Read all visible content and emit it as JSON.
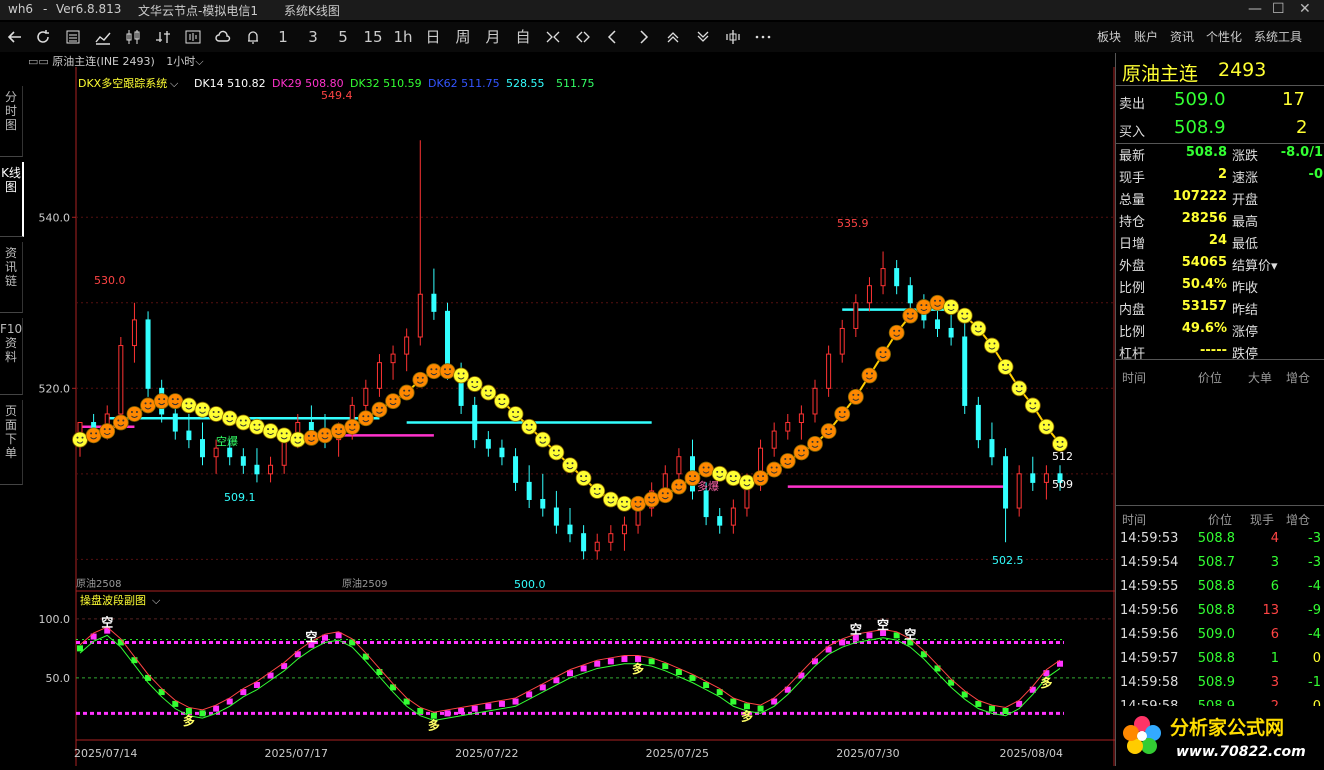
{
  "window": {
    "app_name": "wh6",
    "sep": "-",
    "version": "Ver6.8.813",
    "server": "文华云节点-模拟电信1",
    "view": "系统K线图",
    "controls": [
      "—",
      "☐",
      "✕"
    ]
  },
  "toolbar": {
    "periods": [
      "1",
      "3",
      "5",
      "15",
      "1h",
      "日",
      "周",
      "月",
      "自"
    ],
    "menus": [
      "板块",
      "账户",
      "资讯",
      "个性化",
      "系统工具"
    ]
  },
  "side_tabs": [
    {
      "label": "分时图",
      "active": false
    },
    {
      "label": "K线图",
      "active": true
    },
    {
      "label": "资讯链",
      "active": false
    },
    {
      "label": "F10资料",
      "active": false
    },
    {
      "label": "页面下单",
      "active": false
    }
  ],
  "chart_header": {
    "symbol": "原油主连(INE 2493)",
    "period": "1小时"
  },
  "main_indicator": {
    "name": "DKX多空跟踪系统",
    "items": [
      {
        "label": "DK14",
        "value": "510.82",
        "color": "#ffffff"
      },
      {
        "label": "DK29",
        "value": "508.80",
        "color": "#ff33cc"
      },
      {
        "label": "DK32",
        "value": "510.59",
        "color": "#33ff33"
      },
      {
        "label": "DK62",
        "value": "511.75",
        "color": "#3355ff"
      },
      {
        "label": "",
        "value": "528.55",
        "color": "#33ffff"
      },
      {
        "label": "",
        "value": "511.75",
        "color": "#33ff66"
      }
    ]
  },
  "sub_indicator": {
    "name": "操盘波段副图"
  },
  "contract_labels": [
    "原油2508",
    "原油2509"
  ],
  "chart_data": {
    "type": "candlestick",
    "y_ticks": [
      "540.0",
      "520.0"
    ],
    "sub_y_ticks": [
      "100.0",
      "50.0"
    ],
    "x_ticks": [
      "2025/07/14",
      "2025/07/17",
      "2025/07/22",
      "2025/07/25",
      "2025/07/30",
      "2025/08/04"
    ],
    "ylim": [
      497,
      555
    ],
    "annotations": [
      {
        "text": "530.0",
        "color": "#ff4444"
      },
      {
        "text": "549.4",
        "color": "#ff4444"
      },
      {
        "text": "535.9",
        "color": "#ff4444"
      },
      {
        "text": "509.1",
        "color": "#33ffff"
      },
      {
        "text": "500.0",
        "color": "#33ffff"
      },
      {
        "text": "502.5",
        "color": "#33ffff"
      },
      {
        "text": "512",
        "color": "#ffffff"
      },
      {
        "text": "509",
        "color": "#ffffff"
      }
    ],
    "signals": [
      "空爆",
      "多爆",
      "空",
      "多"
    ],
    "bars": [
      [
        514,
        516,
        512,
        516
      ],
      [
        516,
        517,
        514,
        515
      ],
      [
        515,
        518,
        514,
        517
      ],
      [
        517,
        526,
        516,
        525
      ],
      [
        525,
        530,
        523,
        528
      ],
      [
        528,
        529,
        519,
        520
      ],
      [
        520,
        521,
        516,
        517
      ],
      [
        517,
        519,
        514,
        515
      ],
      [
        515,
        517,
        513,
        514
      ],
      [
        514,
        516,
        511,
        512
      ],
      [
        512,
        514,
        510,
        513
      ],
      [
        513,
        514,
        511,
        512
      ],
      [
        512,
        513,
        510,
        511
      ],
      [
        511,
        513,
        509,
        510
      ],
      [
        510,
        512,
        509,
        511
      ],
      [
        511,
        515,
        510,
        514
      ],
      [
        514,
        517,
        513,
        516
      ],
      [
        516,
        518,
        514,
        515
      ],
      [
        515,
        517,
        513,
        514
      ],
      [
        514,
        516,
        512,
        515
      ],
      [
        515,
        519,
        514,
        518
      ],
      [
        518,
        521,
        517,
        520
      ],
      [
        520,
        524,
        519,
        523
      ],
      [
        523,
        525,
        521,
        524
      ],
      [
        524,
        527,
        522,
        526
      ],
      [
        526,
        549,
        525,
        531
      ],
      [
        531,
        534,
        528,
        529
      ],
      [
        529,
        530,
        521,
        522
      ],
      [
        522,
        523,
        517,
        518
      ],
      [
        518,
        519,
        513,
        514
      ],
      [
        514,
        515,
        512,
        513
      ],
      [
        513,
        514,
        511,
        512
      ],
      [
        512,
        513,
        508,
        509
      ],
      [
        509,
        511,
        506,
        507
      ],
      [
        507,
        510,
        505,
        506
      ],
      [
        506,
        508,
        503,
        504
      ],
      [
        504,
        506,
        502,
        503
      ],
      [
        503,
        504,
        500,
        501
      ],
      [
        501,
        503,
        500,
        502
      ],
      [
        502,
        504,
        501,
        503
      ],
      [
        503,
        505,
        501,
        504
      ],
      [
        504,
        507,
        503,
        506
      ],
      [
        506,
        509,
        505,
        508
      ],
      [
        508,
        511,
        507,
        510
      ],
      [
        510,
        513,
        509,
        512
      ],
      [
        512,
        514,
        507,
        508
      ],
      [
        508,
        509,
        504,
        505
      ],
      [
        505,
        506,
        503,
        504
      ],
      [
        504,
        507,
        503,
        506
      ],
      [
        506,
        510,
        505,
        509
      ],
      [
        509,
        514,
        508,
        513
      ],
      [
        513,
        516,
        512,
        515
      ],
      [
        515,
        517,
        514,
        516
      ],
      [
        516,
        518,
        514,
        517
      ],
      [
        517,
        521,
        516,
        520
      ],
      [
        520,
        525,
        519,
        524
      ],
      [
        524,
        528,
        523,
        527
      ],
      [
        527,
        531,
        526,
        530
      ],
      [
        530,
        533,
        529,
        532
      ],
      [
        532,
        536,
        531,
        534
      ],
      [
        534,
        535,
        531,
        532
      ],
      [
        532,
        533,
        529,
        530
      ],
      [
        530,
        531,
        527,
        528
      ],
      [
        528,
        530,
        526,
        527
      ],
      [
        527,
        529,
        525,
        526
      ],
      [
        526,
        528,
        517,
        518
      ],
      [
        518,
        519,
        513,
        514
      ],
      [
        514,
        516,
        511,
        512
      ],
      [
        512,
        513,
        502,
        506
      ],
      [
        506,
        511,
        505,
        510
      ],
      [
        510,
        512,
        508,
        509
      ],
      [
        509,
        511,
        507,
        510
      ],
      [
        510,
        511,
        508,
        509
      ]
    ],
    "dkx_line": [
      514,
      514.5,
      515,
      516,
      517,
      518,
      518.5,
      518.5,
      518,
      517.5,
      517,
      516.5,
      516,
      515.5,
      515,
      514.5,
      514,
      514.2,
      514.5,
      515,
      515.5,
      516.5,
      517.5,
      518.5,
      519.5,
      521,
      522,
      522,
      521.5,
      520.5,
      519.5,
      518.5,
      517,
      515.5,
      514,
      512.5,
      511,
      509.5,
      508,
      507,
      506.5,
      506.5,
      507,
      507.5,
      508.5,
      509.5,
      510.5,
      510,
      509.5,
      509,
      509.5,
      510.5,
      511.5,
      512.5,
      513.5,
      515,
      517,
      519,
      521.5,
      524,
      526.5,
      528.5,
      529.5,
      530,
      529.5,
      528.5,
      527,
      525,
      522.5,
      520,
      518,
      515.5,
      513.5
    ],
    "sub_kd": [
      75,
      85,
      90,
      80,
      65,
      50,
      38,
      28,
      22,
      20,
      24,
      30,
      38,
      44,
      52,
      60,
      70,
      78,
      84,
      86,
      80,
      68,
      55,
      42,
      30,
      22,
      18,
      20,
      22,
      24,
      26,
      28,
      30,
      36,
      42,
      48,
      54,
      58,
      62,
      64,
      66,
      66,
      64,
      60,
      55,
      50,
      44,
      38,
      30,
      26,
      24,
      30,
      40,
      52,
      64,
      74,
      80,
      84,
      86,
      88,
      86,
      80,
      70,
      58,
      46,
      36,
      28,
      24,
      22,
      28,
      40,
      54,
      62
    ]
  },
  "right_panel": {
    "title": "原油主连",
    "code": "2493",
    "sell_label": "卖出",
    "sell_price": "509.0",
    "sell_vol": "17",
    "buy_label": "买入",
    "buy_price": "508.9",
    "buy_vol": "2",
    "stats_left": [
      {
        "label": "最新",
        "value": "508.8",
        "color": "#33ff33"
      },
      {
        "label": "现手",
        "value": "2",
        "color": "#ffff33"
      },
      {
        "label": "总量",
        "value": "107222",
        "color": "#ffff33"
      },
      {
        "label": "持仓",
        "value": "28256",
        "color": "#ffff33"
      },
      {
        "label": "日增",
        "value": "24",
        "color": "#ffff33"
      },
      {
        "label": "外盘",
        "value": "54065",
        "color": "#ffff33"
      },
      {
        "label": "比例",
        "value": "50.4%",
        "color": "#ffff33"
      },
      {
        "label": "内盘",
        "value": "53157",
        "color": "#ffff33"
      },
      {
        "label": "比例",
        "value": "49.6%",
        "color": "#ffff33"
      },
      {
        "label": "杠杆",
        "value": "-----",
        "color": "#ffff33"
      }
    ],
    "stats_right": [
      {
        "label": "涨跌",
        "value": "-8.0/1",
        "color": "#33ff33"
      },
      {
        "label": "速涨",
        "value": "-0",
        "color": "#33ff33"
      },
      {
        "label": "开盘",
        "value": "",
        "color": "#ffffff"
      },
      {
        "label": "最高",
        "value": "",
        "color": "#ffffff"
      },
      {
        "label": "最低",
        "value": "",
        "color": "#ffffff"
      },
      {
        "label": "结算价",
        "value": "",
        "color": "#ffffff"
      },
      {
        "label": "昨收",
        "value": "",
        "color": "#ffffff"
      },
      {
        "label": "昨结",
        "value": "",
        "color": "#ffffff"
      },
      {
        "label": "涨停",
        "value": "",
        "color": "#ffffff"
      },
      {
        "label": "跌停",
        "value": "",
        "color": "#ffffff"
      }
    ],
    "big_order_headers": [
      "时间",
      "价位",
      "大单",
      "增仓"
    ],
    "tick_headers": [
      "时间",
      "价位",
      "现手",
      "增仓"
    ],
    "ticks": [
      {
        "time": "14:59:53",
        "price": "508.8",
        "vol": "4",
        "chg": "-3",
        "pc": "#33ff33",
        "vc": "#ff4444",
        "cc": "#33ff33"
      },
      {
        "time": "14:59:54",
        "price": "508.7",
        "vol": "3",
        "chg": "-3",
        "pc": "#33ff33",
        "vc": "#33ff33",
        "cc": "#33ff33"
      },
      {
        "time": "14:59:55",
        "price": "508.8",
        "vol": "6",
        "chg": "-4",
        "pc": "#33ff33",
        "vc": "#33ff33",
        "cc": "#33ff33"
      },
      {
        "time": "14:59:56",
        "price": "508.8",
        "vol": "13",
        "chg": "-9",
        "pc": "#33ff33",
        "vc": "#ff4444",
        "cc": "#33ff33"
      },
      {
        "time": "14:59:56",
        "price": "509.0",
        "vol": "6",
        "chg": "-4",
        "pc": "#33ff33",
        "vc": "#ff4444",
        "cc": "#33ff33"
      },
      {
        "time": "14:59:57",
        "price": "508.8",
        "vol": "1",
        "chg": "0",
        "pc": "#33ff33",
        "vc": "#33ff33",
        "cc": "#ffff33"
      },
      {
        "time": "14:59:58",
        "price": "508.9",
        "vol": "3",
        "chg": "-1",
        "pc": "#33ff33",
        "vc": "#ff4444",
        "cc": "#33ff33"
      },
      {
        "time": "14:59:58",
        "price": "508.9",
        "vol": "2",
        "chg": "0",
        "pc": "#33ff33",
        "vc": "#ff4444",
        "cc": "#ffff33"
      }
    ]
  },
  "watermark": {
    "name": "分析家公式网",
    "url": "www.70822.com"
  }
}
